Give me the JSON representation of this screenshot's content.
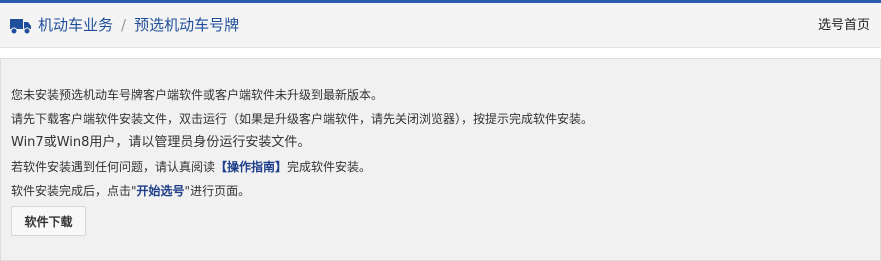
{
  "header": {
    "breadcrumb": {
      "section": "机动车业务",
      "separator": "/",
      "current": "预选机动车号牌"
    },
    "home_link": "选号首页",
    "icons": {
      "truck": "truck-icon"
    }
  },
  "notice": {
    "line1": "您未安装预选机动车号牌客户端软件或客户端软件未升级到最新版本。",
    "line2": "请先下载客户端软件安装文件，双击运行（如果是升级客户端软件，请先关闭浏览器），按提示完成软件安装。",
    "line3": "Win7或Win8用户，请以管理员身份运行安装文件。",
    "line4_before": "若软件安装遇到任何问题，请认真阅读",
    "line4_link": "【操作指南】",
    "line4_after": "完成软件安装。",
    "line5_before": "软件安装完成后，点击\"",
    "line5_link": "开始选号",
    "line5_after": "\"进行页面。"
  },
  "download_button": "软件下载",
  "colors": {
    "accent": "#2a5db0",
    "link": "#1f4f9a",
    "panel_bg": "#f1f1f1"
  }
}
